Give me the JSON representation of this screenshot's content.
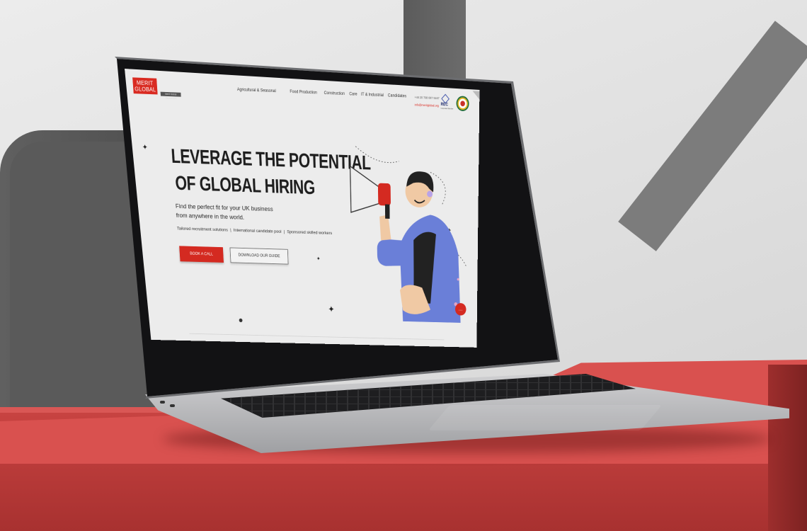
{
  "brand": {
    "line1": "MERIT",
    "line2": "GLOBAL",
    "tagline": "Merit Global Recruitment"
  },
  "nav": {
    "items": [
      {
        "label": "Agricultural & Seasonal"
      },
      {
        "label": "Food Production"
      },
      {
        "label": "Construction"
      },
      {
        "label": "Care"
      },
      {
        "label": "IT & Industrial"
      },
      {
        "label": "Candidates"
      }
    ]
  },
  "contact": {
    "phone": "+44 20 708 087 5167",
    "email": "info@meritglobal.org"
  },
  "accreditation": {
    "rec_label": "REC",
    "rec_sub": "Corporate Member"
  },
  "hero": {
    "title_line1": "LEVERAGE THE POTENTIAL",
    "title_line2": "OF GLOBAL HIRING",
    "subtitle_line1": "Find the perfect fit for your UK business",
    "subtitle_line2": "from anywhere in the world.",
    "tags": [
      "Tailored recruitment solutions",
      "International candidate pool",
      "Sponsored skilled workers"
    ],
    "tag_separator": "|",
    "primary_cta": "BOOK A CALL",
    "secondary_cta": "DOWNLOAD OUR GUIDE"
  },
  "icons": {
    "chat": "chat-bubble-icon",
    "sparkle": "sparkle-icon",
    "megaphone": "megaphone-illustration"
  },
  "colors": {
    "brand_red": "#d42a21",
    "text_dark": "#1e1e1e",
    "screen_bg": "#ececec",
    "illustration_blue": "#6a7fd8"
  }
}
